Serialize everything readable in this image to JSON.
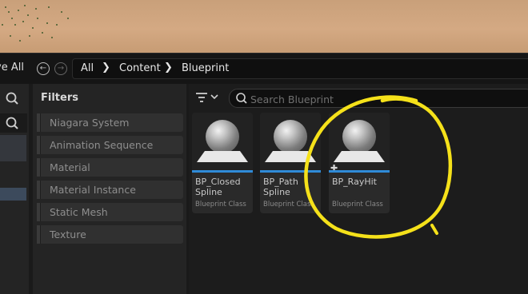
{
  "toolbar": {
    "save_all_label": "ve All",
    "back_icon": "back-arrow-icon",
    "forward_icon": "forward-arrow-icon"
  },
  "breadcrumb": [
    "All",
    "Content",
    "Blueprint"
  ],
  "filters": {
    "title": "Filters",
    "items": [
      "Niagara System",
      "Animation Sequence",
      "Material",
      "Material Instance",
      "Static Mesh",
      "Texture"
    ]
  },
  "search": {
    "placeholder": "Search Blueprint",
    "value": ""
  },
  "assets": [
    {
      "name": "BP_Closed Spline",
      "class": "Blueprint Class"
    },
    {
      "name": "BP_Path Spline",
      "class": "Blueprint Class"
    },
    {
      "name": "BP_RayHit",
      "class": "Blueprint Class"
    }
  ],
  "colors": {
    "accent_blue": "#2f8bd8",
    "annotation_yellow": "#f5e11a",
    "panel_bg": "#242424"
  }
}
